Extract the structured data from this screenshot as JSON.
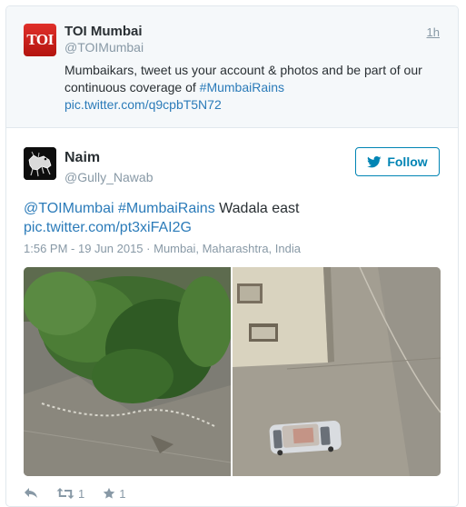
{
  "parent_tweet": {
    "logo_text": "TOI",
    "name": "TOI Mumbai",
    "handle": "@TOIMumbai",
    "time": "1h",
    "text_line1": "Mumbaikars, tweet us your account & photos and be part of our",
    "text_line2_prefix": "continuous coverage of ",
    "hashtag": "#MumbaiRains",
    "pic_link": "pic.twitter.com/q9cpbT5N72"
  },
  "tweet": {
    "name": "Naim",
    "handle": "@Gully_Nawab",
    "follow_label": "Follow",
    "mention": "@TOIMumbai",
    "hashtag": "#MumbaiRains",
    "text_suffix": " Wadala east",
    "pic_link": "pic.twitter.com/pt3xiFAI2G",
    "timestamp": "1:56 PM - 19 Jun 2015",
    "location": "Mumbai, Maharashtra, India",
    "media_alts": [
      "flooded street with tree",
      "flooded street with car from above"
    ]
  },
  "actions": {
    "retweet_count": "1",
    "favorite_count": "1"
  },
  "colors": {
    "link": "#2b7bb9",
    "follow": "#0084b4",
    "muted": "#8899a6",
    "parent_bg": "#f5f8fa"
  }
}
